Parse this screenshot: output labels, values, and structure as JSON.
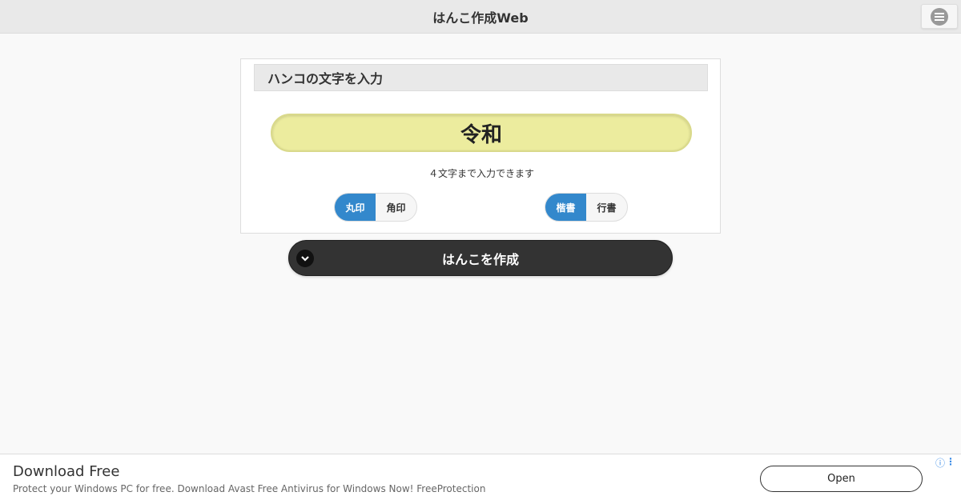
{
  "header": {
    "title": "はんこ作成Web",
    "menu_icon": "menu-icon"
  },
  "panel": {
    "heading": "ハンコの文字を入力",
    "input_value": "令和",
    "hint": "４文字まで入力できます",
    "shape_options": [
      {
        "label": "丸印",
        "active": true
      },
      {
        "label": "角印",
        "active": false
      }
    ],
    "style_options": [
      {
        "label": "楷書",
        "active": true
      },
      {
        "label": "行書",
        "active": false
      }
    ]
  },
  "create_button": {
    "label": "はんこを作成",
    "icon": "chevron-down-icon"
  },
  "ad": {
    "title": "Download Free",
    "description": "Protect your Windows PC for free. Download Avast Free Antivirus for Windows Now! FreeProtection",
    "open_label": "Open",
    "info_glyph": "ⓘ",
    "more_glyph": "⋮"
  },
  "colors": {
    "accent": "#3388cc",
    "input_bg": "#ecec9e",
    "button_bg": "#333333"
  }
}
